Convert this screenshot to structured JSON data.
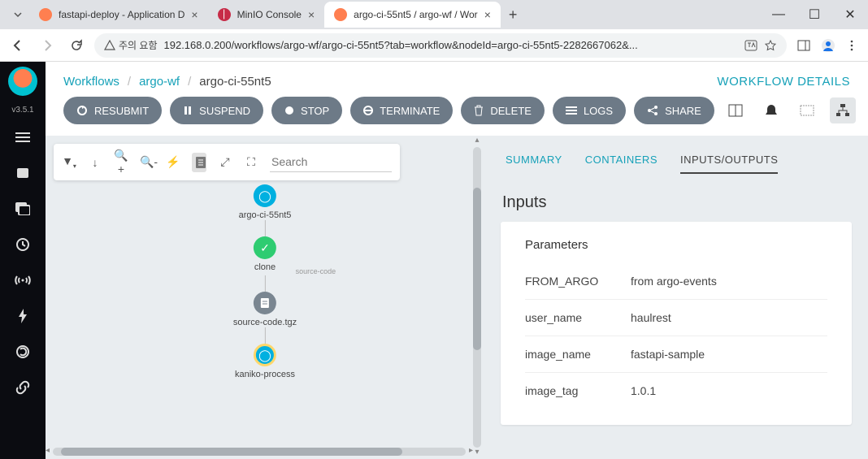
{
  "browser": {
    "tabs": [
      {
        "title": "fastapi-deploy - Application D",
        "favicon": "argo"
      },
      {
        "title": "MinIO Console",
        "favicon": "minio"
      },
      {
        "title": "argo-ci-55nt5 / argo-wf / Wor",
        "favicon": "argo",
        "active": true
      }
    ],
    "url_warning": "주의 요함",
    "url": "192.168.0.200/workflows/argo-wf/argo-ci-55nt5?tab=workflow&nodeId=argo-ci-55nt5-2282667062&..."
  },
  "sidebar": {
    "version": "v3.5.1"
  },
  "header": {
    "breadcrumbs": [
      "Workflows",
      "argo-wf",
      "argo-ci-55nt5"
    ],
    "details_label": "WORKFLOW DETAILS"
  },
  "actions": {
    "resubmit": "RESUBMIT",
    "suspend": "SUSPEND",
    "stop": "STOP",
    "terminate": "TERMINATE",
    "delete": "DELETE",
    "logs": "LOGS",
    "share": "SHARE"
  },
  "graph": {
    "search_placeholder": "Search",
    "nodes": {
      "root": "argo-ci-55nt5",
      "clone": "clone",
      "artifact_label": "source-code",
      "artifact": "source-code.tgz",
      "kaniko": "kaniko-process"
    }
  },
  "details": {
    "tabs": {
      "summary": "SUMMARY",
      "containers": "CONTAINERS",
      "io": "INPUTS/OUTPUTS"
    },
    "inputs_title": "Inputs",
    "parameters_title": "Parameters",
    "parameters": [
      {
        "key": "FROM_ARGO",
        "value": "from argo-events"
      },
      {
        "key": "user_name",
        "value": "haulrest"
      },
      {
        "key": "image_name",
        "value": "fastapi-sample"
      },
      {
        "key": "image_tag",
        "value": "1.0.1"
      }
    ]
  }
}
